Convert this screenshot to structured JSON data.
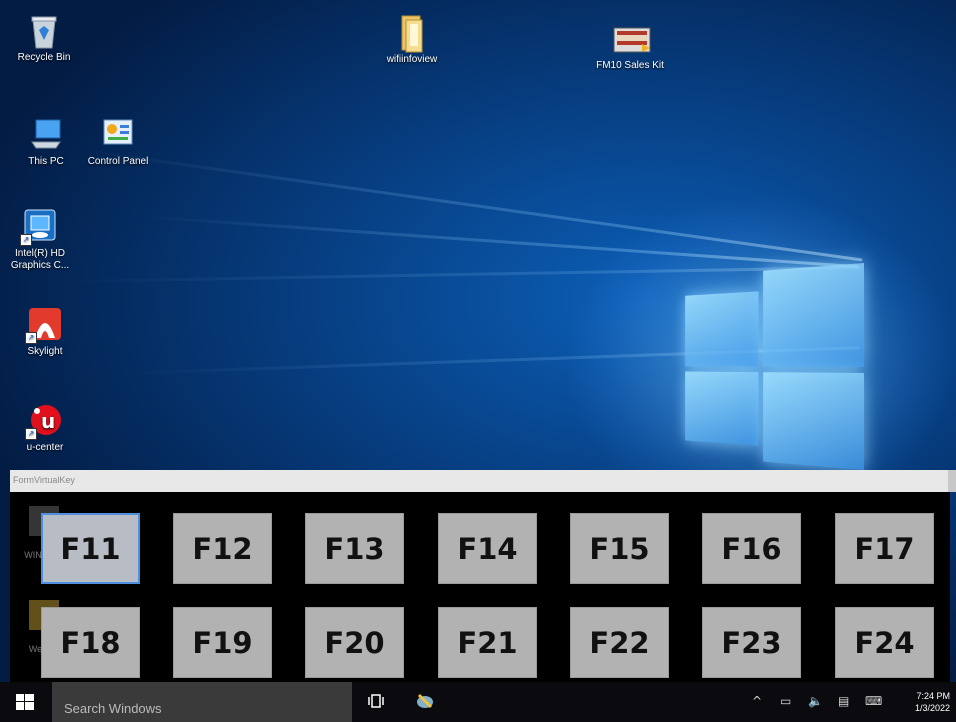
{
  "desktop": {
    "icons": [
      {
        "label": "Recycle Bin"
      },
      {
        "label": "wifiinfoview"
      },
      {
        "label": "FM10 Sales Kit"
      },
      {
        "label": "This PC"
      },
      {
        "label": "Control Panel"
      },
      {
        "label": "Intel(R) HD Graphics C..."
      },
      {
        "label": "Skylight"
      },
      {
        "label": "u-center"
      },
      {
        "label": "WIN-Ca..."
      },
      {
        "label": "WeeGo"
      }
    ]
  },
  "virtual_keyboard": {
    "window_title": "FormVirtualKey",
    "selected_key": "F11",
    "row1": [
      "F11",
      "F12",
      "F13",
      "F14",
      "F15",
      "F16",
      "F17"
    ],
    "row2": [
      "F18",
      "F19",
      "F20",
      "F21",
      "F22",
      "F23",
      "F24"
    ]
  },
  "taskbar": {
    "search_placeholder": "Search Windows",
    "time": "7:24 PM",
    "date": "1/3/2022"
  },
  "colors": {
    "key_bg": "#b2b2b2",
    "selected_border": "#4f8fdf",
    "taskbar_bg": "#0b0b0f"
  }
}
